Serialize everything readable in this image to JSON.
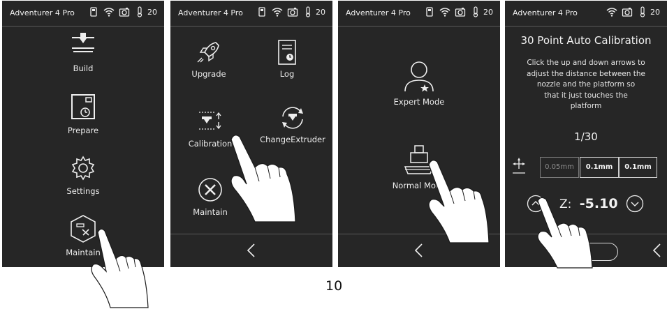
{
  "status": {
    "app_title": "Adventurer 4 Pro",
    "temperature": "20"
  },
  "panel1": {
    "items": [
      "Build",
      "Prepare",
      "Settings",
      "Maintain"
    ]
  },
  "panel2": {
    "items": [
      "Upgrade",
      "Log",
      "Calibration",
      "ChangeExtruder",
      "Maintain"
    ]
  },
  "panel3": {
    "items": [
      "Expert Mode",
      "Normal Mode"
    ]
  },
  "panel4": {
    "title": "30 Point Auto Calibration",
    "instructions": [
      "Click the up and down arrows to",
      "adjust the distance between the",
      "nozzle and the platform so",
      "that it just touches the",
      "platform"
    ],
    "progress": "1/30",
    "steps": [
      "0.05mm",
      "0.1mm",
      "0.1mm"
    ],
    "z_label": "Z:",
    "z_value": "-5.10"
  },
  "page_number": "10"
}
